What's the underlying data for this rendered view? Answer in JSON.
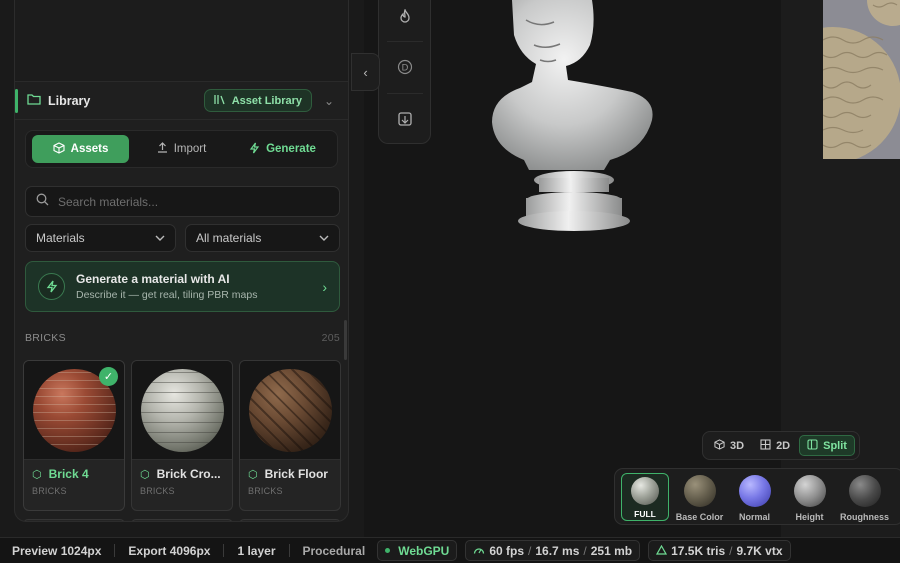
{
  "library": {
    "title": "Library",
    "asset_library_label": "Asset Library",
    "tabs": [
      {
        "label": "Assets",
        "icon": "cube-icon"
      },
      {
        "label": "Import",
        "icon": "upload-icon"
      },
      {
        "label": "Generate",
        "icon": "bolt-icon"
      }
    ],
    "search_placeholder": "Search materials...",
    "type_select": "Materials",
    "filter_select": "All materials",
    "ai_card": {
      "title": "Generate a material with AI",
      "subtitle": "Describe it — get real, tiling PBR maps"
    },
    "section": {
      "label": "BRICKS",
      "count": "205"
    },
    "materials": [
      {
        "name": "Brick 4",
        "category": "BRICKS",
        "selected": true
      },
      {
        "name": "Brick Cro...",
        "category": "BRICKS",
        "selected": false
      },
      {
        "name": "Brick Floor",
        "category": "BRICKS",
        "selected": false
      }
    ]
  },
  "viewport": {
    "toolbar_icons": [
      "flame-icon",
      "coin-icon",
      "image-export-icon"
    ],
    "view_modes": [
      {
        "label": "3D",
        "icon": "cube-icon",
        "active": false
      },
      {
        "label": "2D",
        "icon": "grid-icon",
        "active": false
      },
      {
        "label": "Split",
        "icon": "split-icon",
        "active": true
      }
    ],
    "channels": [
      {
        "label": "FULL",
        "active": true,
        "color": "#8b8f86"
      },
      {
        "label": "Base Color",
        "active": false,
        "color": "#5e5a4a"
      },
      {
        "label": "Normal",
        "active": false,
        "color": "#7070e0"
      },
      {
        "label": "Height",
        "active": false,
        "color": "#8a8a8a"
      },
      {
        "label": "Roughness",
        "active": false,
        "color": "#4a4a4a"
      }
    ]
  },
  "status": {
    "preview": "Preview 1024px",
    "export": "Export 4096px",
    "layers": "1 layer",
    "mode": "Procedural",
    "backend": "WebGPU",
    "fps": "60 fps",
    "ms": "16.7 ms",
    "mem": "251 mb",
    "tris": "17.5K tris",
    "vtx": "9.7K vtx"
  },
  "colors": {
    "accent": "#3fb36a",
    "accent_text": "#6fdb93"
  }
}
